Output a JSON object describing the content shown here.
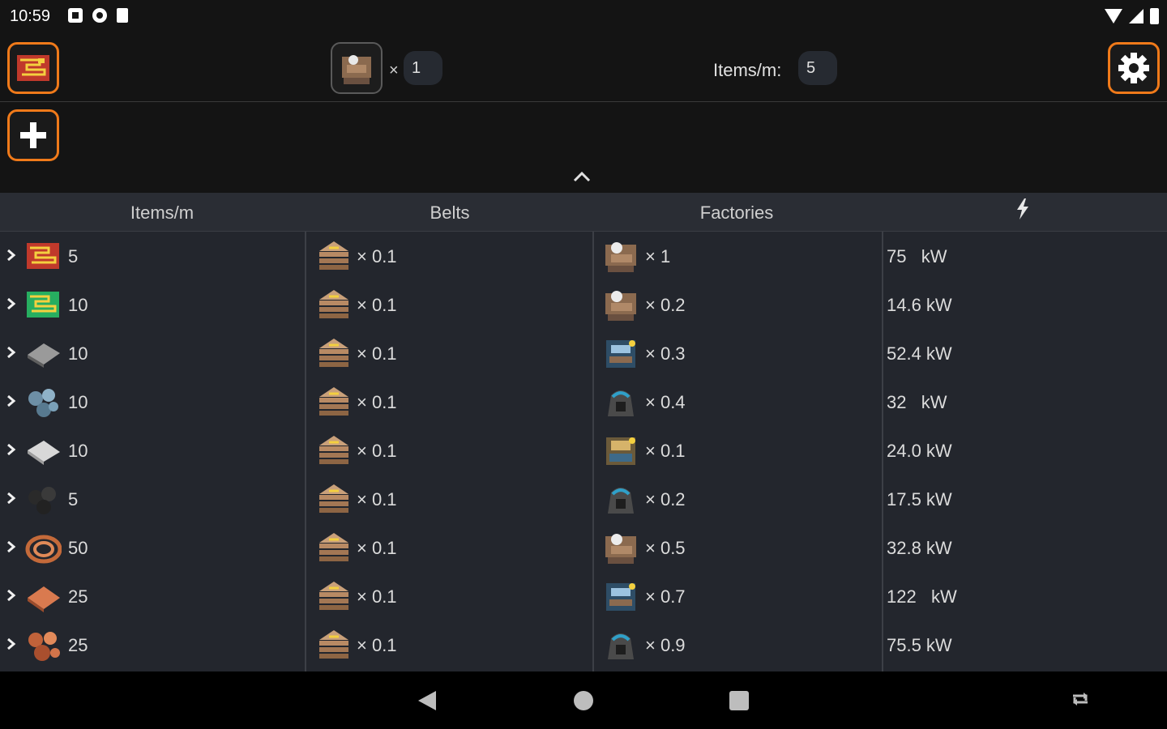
{
  "status_bar": {
    "time": "10:59"
  },
  "toolbar": {
    "target_multiplier_prefix": "×",
    "target_multiplier_value": "1",
    "items_per_min_label": "Items/m:",
    "items_per_min_value": "5"
  },
  "table": {
    "headers": {
      "items": "Items/m",
      "belts": "Belts",
      "factories": "Factories",
      "power_icon": "lightning-icon"
    },
    "rows": [
      {
        "item_icon": "circuit-red-icon",
        "items": "5",
        "belts": "× 0.1",
        "factory_icon": "assembler-icon",
        "factories": "× 1",
        "power": "75   kW"
      },
      {
        "item_icon": "circuit-green-icon",
        "items": "10",
        "belts": "× 0.1",
        "factory_icon": "assembler-icon",
        "factories": "× 0.2",
        "power": "14.6 kW"
      },
      {
        "item_icon": "plate-steel-icon",
        "items": "10",
        "belts": "× 0.1",
        "factory_icon": "machine-blue-icon",
        "factories": "× 0.3",
        "power": "52.4 kW"
      },
      {
        "item_icon": "ore-iron-icon",
        "items": "10",
        "belts": "× 0.1",
        "factory_icon": "drill-icon",
        "factories": "× 0.4",
        "power": "32   kW"
      },
      {
        "item_icon": "plate-iron-icon",
        "items": "10",
        "belts": "× 0.1",
        "factory_icon": "machine-yellow-icon",
        "factories": "× 0.1",
        "power": "24.0 kW"
      },
      {
        "item_icon": "coal-icon",
        "items": "5",
        "belts": "× 0.1",
        "factory_icon": "drill-icon",
        "factories": "× 0.2",
        "power": "17.5 kW"
      },
      {
        "item_icon": "copper-cable-icon",
        "items": "50",
        "belts": "× 0.1",
        "factory_icon": "assembler-icon",
        "factories": "× 0.5",
        "power": "32.8 kW"
      },
      {
        "item_icon": "plate-copper-icon",
        "items": "25",
        "belts": "× 0.1",
        "factory_icon": "machine-blue-icon",
        "factories": "× 0.7",
        "power": "122   kW"
      },
      {
        "item_icon": "ore-copper-icon",
        "items": "25",
        "belts": "× 0.1",
        "factory_icon": "drill-icon",
        "factories": "× 0.9",
        "power": "75.5 kW"
      }
    ]
  },
  "colors": {
    "accent": "#f07a1a",
    "table_bg": "#23262d",
    "header_bg": "#2a2d34",
    "app_bg": "#141414"
  }
}
